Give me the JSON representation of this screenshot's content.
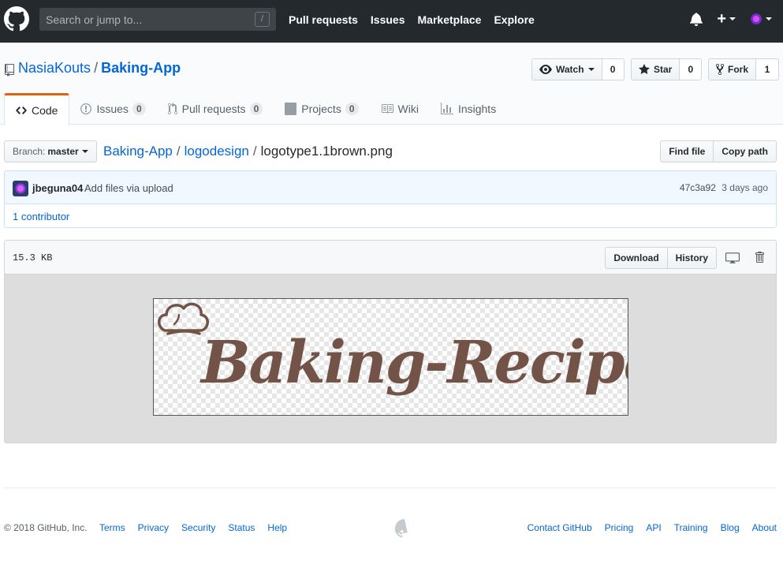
{
  "header": {
    "search_placeholder": "Search or jump to...",
    "search_shortcut": "/",
    "nav": [
      "Pull requests",
      "Issues",
      "Marketplace",
      "Explore"
    ],
    "plus": "+"
  },
  "repo": {
    "owner": "NasiaKouts",
    "separator": "/",
    "name": "Baking-App",
    "watch": {
      "label": "Watch",
      "count": "0"
    },
    "star": {
      "label": "Star",
      "count": "0"
    },
    "fork": {
      "label": "Fork",
      "count": "1"
    }
  },
  "tabs": [
    {
      "label": "Code",
      "counter": null
    },
    {
      "label": "Issues",
      "counter": "0"
    },
    {
      "label": "Pull requests",
      "counter": "0"
    },
    {
      "label": "Projects",
      "counter": "0"
    },
    {
      "label": "Wiki",
      "counter": null
    },
    {
      "label": "Insights",
      "counter": null
    }
  ],
  "file_nav": {
    "branch_label": "Branch:",
    "branch_value": "master",
    "breadcrumb": [
      "Baking-App",
      "logodesign"
    ],
    "sep": "/",
    "filename": "logotype1.1brown.png",
    "find_file": "Find file",
    "copy_path": "Copy path"
  },
  "commit": {
    "author": "jbeguna04",
    "message": "Add files via upload",
    "sha": "47c3a92",
    "time": "3 days ago",
    "contributors": "1 contributor"
  },
  "file": {
    "size": "15.3 KB",
    "download": "Download",
    "history": "History",
    "image_text": "Baking-Recipes"
  },
  "footer": {
    "copyright": "© 2018 GitHub, Inc.",
    "left_links": [
      "Terms",
      "Privacy",
      "Security",
      "Status",
      "Help"
    ],
    "right_links": [
      "Contact GitHub",
      "Pricing",
      "API",
      "Training",
      "Blog",
      "About"
    ]
  },
  "colors": {
    "header_bg": "#24292e",
    "link": "#0366d6",
    "tab_accent": "#e36209",
    "logo_brown": "#735347"
  }
}
